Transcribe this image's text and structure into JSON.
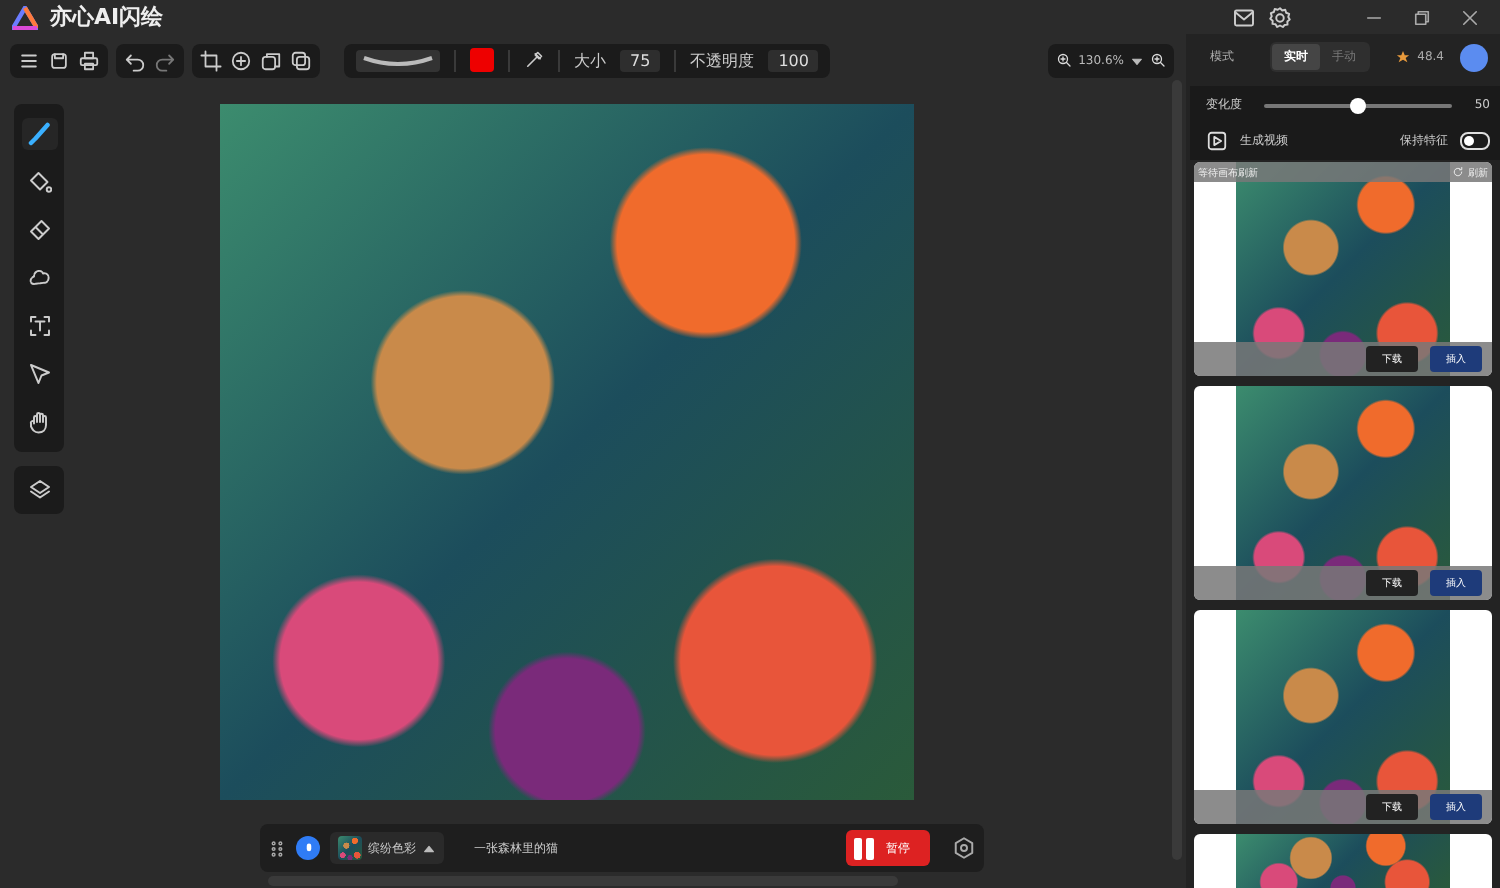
{
  "app": {
    "title": "亦心AI闪绘"
  },
  "toolbar": {
    "size_label": "大小",
    "size_value": "75",
    "opacity_label": "不透明度",
    "opacity_value": "100"
  },
  "zoom": {
    "value": "130.6%"
  },
  "tools": [
    {
      "kind": "brush",
      "selected": true
    },
    {
      "kind": "fill",
      "selected": false
    },
    {
      "kind": "eraser",
      "selected": false
    },
    {
      "kind": "lasso",
      "selected": false
    },
    {
      "kind": "text",
      "selected": false
    },
    {
      "kind": "pointer",
      "selected": false
    },
    {
      "kind": "hand",
      "selected": false
    }
  ],
  "panel": {
    "mode_label": "模式",
    "modes": [
      {
        "label": "实时",
        "selected": true
      },
      {
        "label": "手动",
        "selected": false
      }
    ],
    "credits": "48.4",
    "variation": {
      "label": "变化度",
      "level": 0.5,
      "reading": "50"
    },
    "video_label": "生成视频",
    "keep": {
      "label": "保持特征",
      "on": false
    }
  },
  "results": [
    {
      "kind": "pending",
      "status": "等待画布刷新",
      "refresh": "刷新",
      "download": "下载",
      "insert": "插入"
    },
    {
      "kind": "ready",
      "download": "下载",
      "insert": "插入"
    },
    {
      "kind": "ready",
      "download": "下载",
      "insert": "插入"
    },
    {
      "kind": "partial"
    }
  ],
  "prompt_bar": {
    "style": "缤纷色彩",
    "prompt": "一张森林里的猫",
    "pause": "暂停"
  }
}
